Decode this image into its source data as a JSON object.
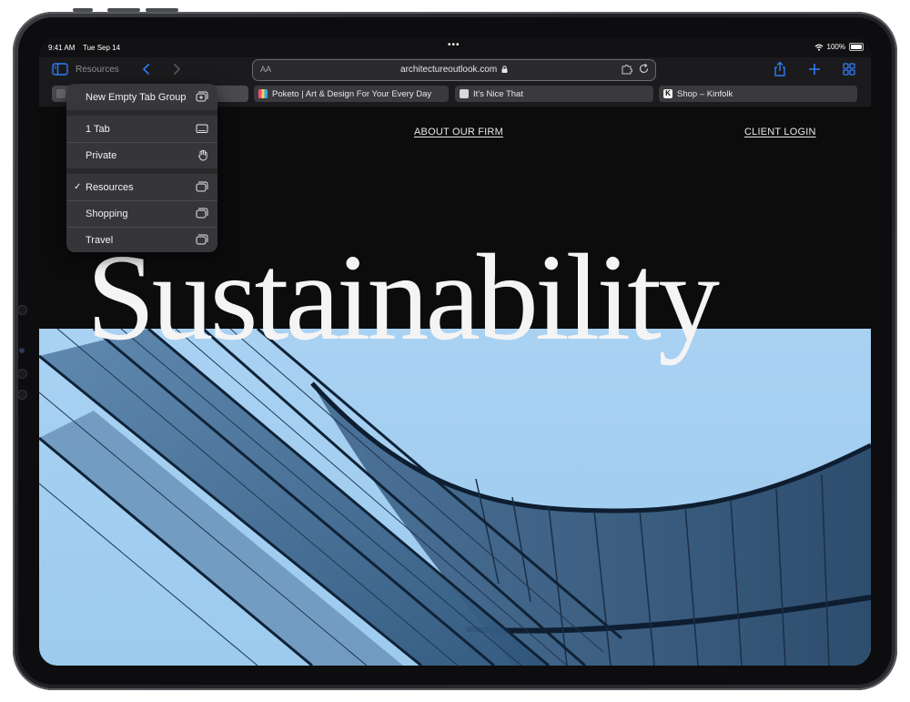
{
  "status_bar": {
    "time": "9:41 AM",
    "date": "Tue Sep 14",
    "battery": "100%"
  },
  "toolbar": {
    "tab_group_name": "Resources",
    "text_size_label": "AA",
    "url": "architectureoutlook.com",
    "accent_color": "#2f7cf6"
  },
  "tabs": [
    {
      "title": "Poketo | Art & Design For Your Every Day",
      "favicon": "poketo-icon"
    },
    {
      "title": "It's Nice That",
      "favicon": "itsnicethat-icon"
    },
    {
      "title": "Shop – Kinfolk",
      "favicon": "kinfolk-icon"
    }
  ],
  "tab_group_menu": {
    "new_group": "New Empty Tab Group",
    "items": [
      {
        "label": "1 Tab",
        "icon": "ipad-icon",
        "checked": false
      },
      {
        "label": "Private",
        "icon": "hand-icon",
        "checked": false
      },
      {
        "label": "Resources",
        "icon": "tabs-icon",
        "checked": true
      },
      {
        "label": "Shopping",
        "icon": "tabs-icon",
        "checked": false
      },
      {
        "label": "Travel",
        "icon": "tabs-icon",
        "checked": false
      }
    ],
    "check_mark": "✓"
  },
  "page": {
    "nav": {
      "about": "ABOUT OUR FIRM",
      "client_login": "CLIENT LOGIN"
    },
    "hero_title": "Sustainability"
  }
}
